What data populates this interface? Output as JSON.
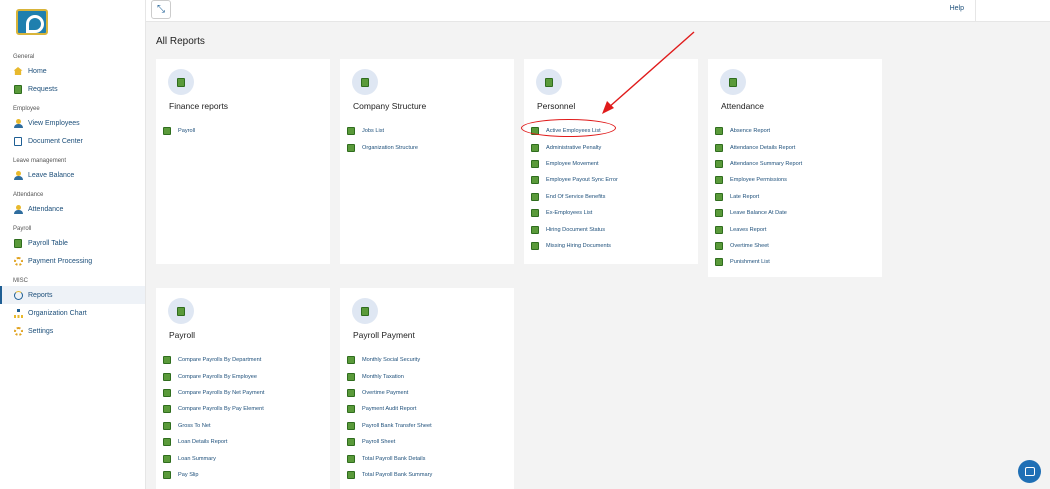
{
  "app": {
    "logo": "company-logo"
  },
  "topbar": {
    "help_label": "Help",
    "toggle_icon": "collapse-arrows-icon"
  },
  "page": {
    "title": "All Reports"
  },
  "sidebar": {
    "sections": [
      {
        "label": "General",
        "items": [
          {
            "label": "Home",
            "icon": "home-icon"
          },
          {
            "label": "Requests",
            "icon": "document-icon"
          }
        ]
      },
      {
        "label": "Employee",
        "items": [
          {
            "label": "View Employees",
            "icon": "user-icon"
          },
          {
            "label": "Document Center",
            "icon": "id-card-icon"
          }
        ]
      },
      {
        "label": "Leave management",
        "items": [
          {
            "label": "Leave Balance",
            "icon": "leave-icon"
          }
        ]
      },
      {
        "label": "Attendance",
        "items": [
          {
            "label": "Attendance",
            "icon": "attendance-icon"
          }
        ]
      },
      {
        "label": "Payroll",
        "items": [
          {
            "label": "Payroll Table",
            "icon": "table-icon"
          },
          {
            "label": "Payment Processing",
            "icon": "gear-icon"
          }
        ]
      },
      {
        "label": "MISC",
        "items": [
          {
            "label": "Reports",
            "icon": "pie-chart-icon",
            "active": true
          },
          {
            "label": "Organization Chart",
            "icon": "org-chart-icon"
          },
          {
            "label": "Settings",
            "icon": "settings-icon"
          }
        ]
      }
    ]
  },
  "cards": [
    {
      "title": "Finance reports",
      "items": [
        "Payroll"
      ]
    },
    {
      "title": "Company Structure",
      "items": [
        "Jobs List",
        "Organization Structure"
      ]
    },
    {
      "title": "Personnel",
      "items": [
        "Active Employees List",
        "Administrative Penalty",
        "Employee Movement",
        "Employee Payout Sync Error",
        "End Of Service Benefits",
        "Ex-Employees List",
        "Hiring Document Status",
        "Missing Hiring Documents"
      ]
    },
    {
      "title": "Attendance",
      "items": [
        "Absence Report",
        "Attendance Details Report",
        "Attendance Summary Report",
        "Employee Permissions",
        "Late Report",
        "Leave Balance At Date",
        "Leaves Report",
        "Overtime Sheet",
        "Punishment List"
      ]
    },
    {
      "title": "Payroll",
      "items": [
        "Compare Payrolls By Department",
        "Compare Payrolls By Employee",
        "Compare Payrolls By Net Payment",
        "Compare Payrolls By Pay Element",
        "Gross To Net",
        "Loan Details Report",
        "Loan Summary",
        "Pay Slip"
      ]
    },
    {
      "title": "Payroll Payment",
      "items": [
        "Monthly Social Security",
        "Monthly Taxation",
        "Overtime Payment",
        "Payment Audit Report",
        "Payroll Bank Transfer Sheet",
        "Payroll Sheet",
        "Total Payroll Bank Details",
        "Total Payroll Bank Summary"
      ]
    }
  ],
  "annotation": {
    "highlight_color": "#e01b1b"
  },
  "colors": {
    "accent": "#1f5f94",
    "link": "#1d4f7a",
    "icon_green": "#5a9a3a",
    "icon_yellow": "#e8b92d"
  }
}
